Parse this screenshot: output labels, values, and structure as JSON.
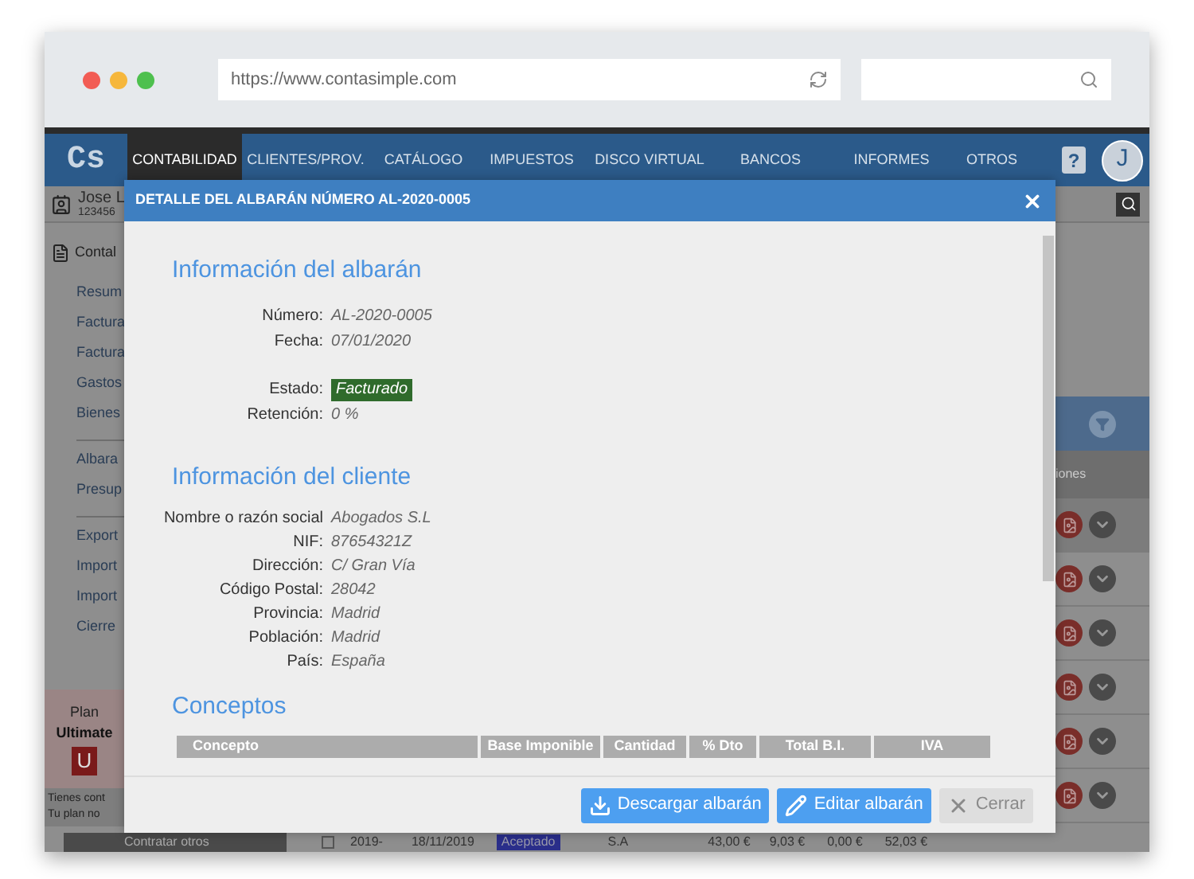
{
  "browser": {
    "url": "https://www.contasimple.com"
  },
  "nav": {
    "logo": "Cs",
    "avatar": "J",
    "help": "?",
    "items": [
      {
        "label": "CONTABILIDAD",
        "selected": true
      },
      {
        "label": "CLIENTES/PROV.",
        "selected": false
      },
      {
        "label": "CATÁLOGO",
        "selected": false
      },
      {
        "label": "IMPUESTOS",
        "selected": false
      },
      {
        "label": "DISCO VIRTUAL",
        "selected": false
      },
      {
        "label": "BANCOS",
        "selected": false
      },
      {
        "label": "INFORMES",
        "selected": false
      },
      {
        "label": "OTROS",
        "selected": false
      }
    ]
  },
  "user": {
    "name": "Jose L",
    "id": "123456"
  },
  "sidebar": {
    "section": "Contal",
    "groups": [
      [
        "Resum",
        "Factura",
        "Factura",
        "Gastos",
        "Bienes"
      ],
      [
        "Albara",
        "Presup"
      ],
      [
        "Export",
        "Import",
        "Import",
        "Cierre"
      ]
    ]
  },
  "plan": {
    "label": "Plan",
    "name": "Ultimate",
    "badge": "U"
  },
  "notice": [
    "Tienes cont",
    "Tu plan no"
  ],
  "contract_button": "Contratar otros",
  "list_header": "iones",
  "bottom_row_checked": false,
  "bottom_row": [
    {
      "kind": "text",
      "text": "2019-"
    },
    {
      "kind": "text",
      "text": "18/11/2019"
    },
    {
      "kind": "badge",
      "text": "Aceptado"
    },
    {
      "kind": "text",
      "text": "S.A"
    },
    {
      "kind": "text",
      "text": "43,00 €"
    },
    {
      "kind": "text",
      "text": "9,03 €"
    },
    {
      "kind": "text",
      "text": "0,00 €"
    },
    {
      "kind": "text",
      "text": "52,03 €"
    }
  ],
  "modal": {
    "title": "DETALLE DEL ALBARÁN NÚMERO AL-2020-0005",
    "albaran": {
      "heading": "Información del albarán",
      "groups": [
        [
          {
            "label": "Número:",
            "value": "AL-2020-0005",
            "kind": "text"
          },
          {
            "label": "Fecha:",
            "value": "07/01/2020",
            "kind": "text"
          }
        ],
        [
          {
            "label": "Estado:",
            "value": "Facturado",
            "kind": "badge"
          },
          {
            "label": "Retención:",
            "value": "0 %",
            "kind": "text"
          }
        ]
      ]
    },
    "client": {
      "heading": "Información del cliente",
      "fields": [
        {
          "label": "Nombre o razón social",
          "value": "Abogados S.L"
        },
        {
          "label": "NIF:",
          "value": "87654321Z"
        },
        {
          "label": "Dirección:",
          "value": "C/ Gran Vía"
        },
        {
          "label": "Código Postal:",
          "value": "28042"
        },
        {
          "label": "Provincia:",
          "value": "Madrid"
        },
        {
          "label": "Población:",
          "value": "Madrid"
        },
        {
          "label": "País:",
          "value": "España"
        }
      ]
    },
    "concepts": {
      "heading": "Conceptos",
      "columns": [
        "Concepto",
        "Base Imponible",
        "Cantidad",
        "% Dto",
        "Total B.I.",
        "IVA"
      ]
    },
    "buttons": [
      {
        "kind": "download",
        "label": "Descargar albarán"
      },
      {
        "kind": "edit",
        "label": "Editar albarán"
      },
      {
        "kind": "close",
        "label": "Cerrar"
      }
    ]
  }
}
